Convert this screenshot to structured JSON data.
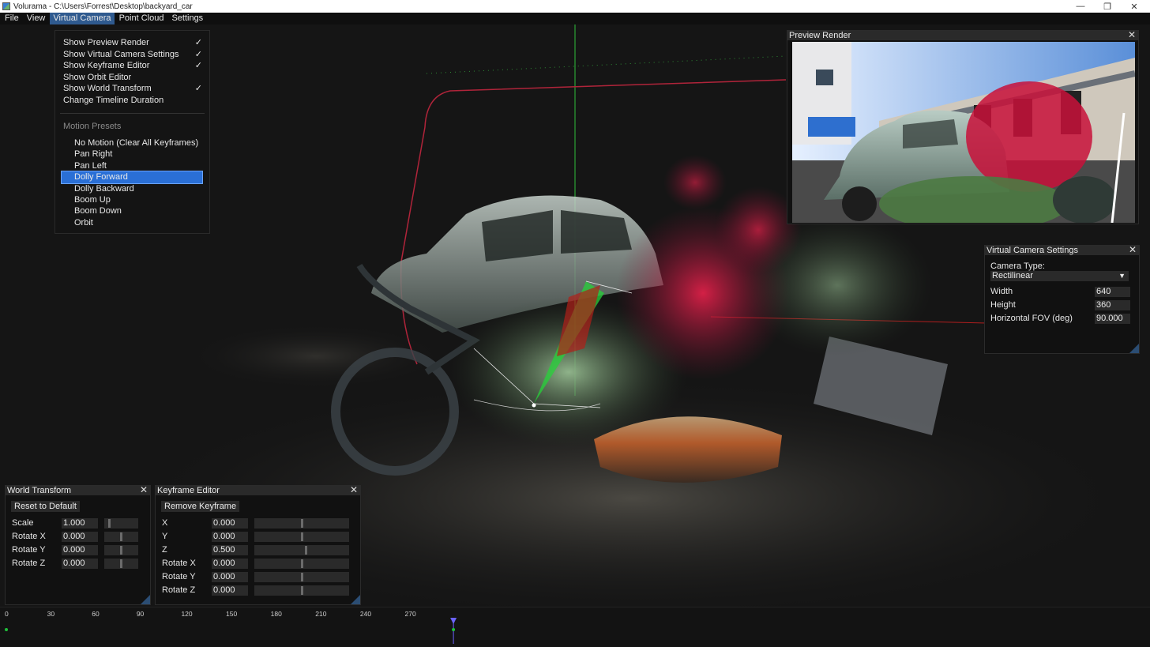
{
  "titlebar": {
    "title": "Volurama - C:\\Users\\Forrest\\Desktop\\backyard_car",
    "minimize": "—",
    "maximize": "❐",
    "close": "✕"
  },
  "menubar": {
    "items": [
      "File",
      "View",
      "Virtual Camera",
      "Point Cloud",
      "Settings"
    ],
    "active": "Virtual Camera"
  },
  "dropdown": {
    "items": [
      {
        "label": "Show Preview Render",
        "checked": "✓"
      },
      {
        "label": "Show Virtual Camera Settings",
        "checked": "✓"
      },
      {
        "label": "Show Keyframe Editor",
        "checked": "✓"
      },
      {
        "label": "Show Orbit Editor",
        "checked": ""
      },
      {
        "label": "Show World Transform",
        "checked": "✓"
      },
      {
        "label": "Change Timeline Duration",
        "checked": ""
      }
    ],
    "section_title": "Motion Presets",
    "presets": [
      "No Motion (Clear All Keyframes)",
      "Pan Right",
      "Pan Left",
      "Dolly Forward",
      "Dolly Backward",
      "Boom Up",
      "Boom Down",
      "Orbit"
    ],
    "selected_preset": "Dolly Forward"
  },
  "preview_render": {
    "title": "Preview Render",
    "close": "✕"
  },
  "camera_settings": {
    "title": "Virtual Camera Settings",
    "close": "✕",
    "camera_type_label": "Camera Type:",
    "camera_type_value": "Rectilinear",
    "width_label": "Width",
    "width_value": "640",
    "height_label": "Height",
    "height_value": "360",
    "fov_label": "Horizontal FOV (deg)",
    "fov_value": "90.000"
  },
  "world_transform": {
    "title": "World Transform",
    "close": "✕",
    "reset_label": "Reset to Default",
    "rows": [
      {
        "label": "Scale",
        "value": "1.000",
        "slider": 0.12
      },
      {
        "label": "Rotate X",
        "value": "0.000",
        "slider": 0.5
      },
      {
        "label": "Rotate Y",
        "value": "0.000",
        "slider": 0.5
      },
      {
        "label": "Rotate Z",
        "value": "0.000",
        "slider": 0.5
      }
    ]
  },
  "keyframe_editor": {
    "title": "Keyframe Editor",
    "close": "✕",
    "remove_label": "Remove Keyframe",
    "rows": [
      {
        "label": "X",
        "value": "0.000",
        "slider": 0.5
      },
      {
        "label": "Y",
        "value": "0.000",
        "slider": 0.5
      },
      {
        "label": "Z",
        "value": "0.500",
        "slider": 0.55
      },
      {
        "label": "Rotate X",
        "value": "0.000",
        "slider": 0.5
      },
      {
        "label": "Rotate Y",
        "value": "0.000",
        "slider": 0.5
      },
      {
        "label": "Rotate Z",
        "value": "0.000",
        "slider": 0.5
      }
    ]
  },
  "timeline": {
    "ticks": [
      "0",
      "30",
      "60",
      "90",
      "120",
      "150",
      "180",
      "210",
      "240",
      "270"
    ],
    "playhead_frame": 300,
    "colors": {
      "keyframe": "#1fbf3a",
      "playhead": "#6b63ff"
    }
  }
}
